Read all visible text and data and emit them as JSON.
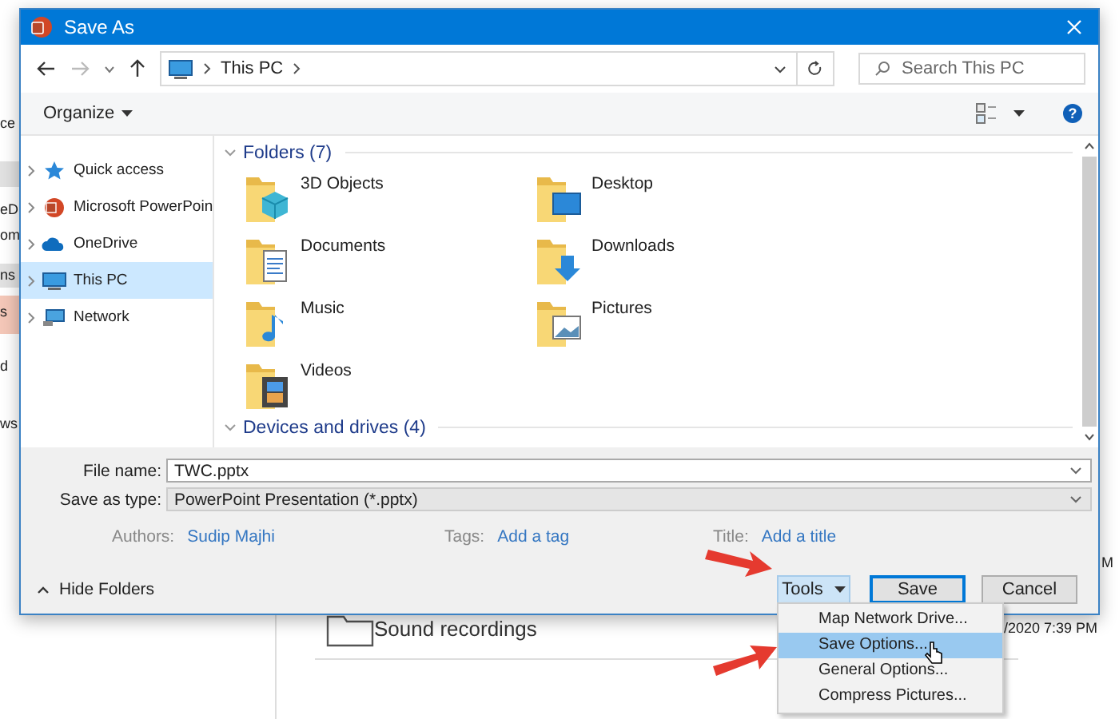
{
  "background": {
    "fragments": [
      "ce",
      "eD",
      "om",
      "ns",
      "s",
      "d",
      "ws",
      "M",
      "/2020 7:39 PM"
    ],
    "list_item": "Sound recordings"
  },
  "dialog": {
    "title": "Save As",
    "address": {
      "crumbs": [
        "This PC"
      ]
    },
    "search": {
      "placeholder": "Search This PC"
    },
    "toolbar": {
      "organize": "Organize",
      "help": "?"
    },
    "sidebar": {
      "items": [
        {
          "label": "Quick access",
          "selected": false
        },
        {
          "label": "Microsoft PowerPoin",
          "selected": false
        },
        {
          "label": "OneDrive",
          "selected": false
        },
        {
          "label": "This PC",
          "selected": true
        },
        {
          "label": "Network",
          "selected": false
        }
      ]
    },
    "sections": [
      {
        "title": "Folders (7)",
        "items": [
          "3D Objects",
          "Desktop",
          "Documents",
          "Downloads",
          "Music",
          "Pictures",
          "Videos"
        ]
      },
      {
        "title": "Devices and drives (4)"
      }
    ],
    "fields": [
      {
        "label": "File name:",
        "value": "TWC.pptx",
        "kind": "input"
      },
      {
        "label": "Save as type:",
        "value": "PowerPoint Presentation (*.pptx)",
        "kind": "select"
      }
    ],
    "meta": [
      {
        "label": "Authors:",
        "value": "Sudip Majhi"
      },
      {
        "label": "Tags:",
        "value": "Add a tag"
      },
      {
        "label": "Title:",
        "value": "Add a title"
      }
    ],
    "hide_folders": "Hide Folders",
    "buttons": {
      "tools": "Tools",
      "save": "Save",
      "cancel": "Cancel"
    },
    "tools_menu": [
      {
        "label": "Map Network Drive...",
        "selected": false
      },
      {
        "label": "Save Options...",
        "selected": true
      },
      {
        "label": "General Options...",
        "selected": false
      },
      {
        "label": "Compress Pictures...",
        "selected": false
      }
    ]
  }
}
